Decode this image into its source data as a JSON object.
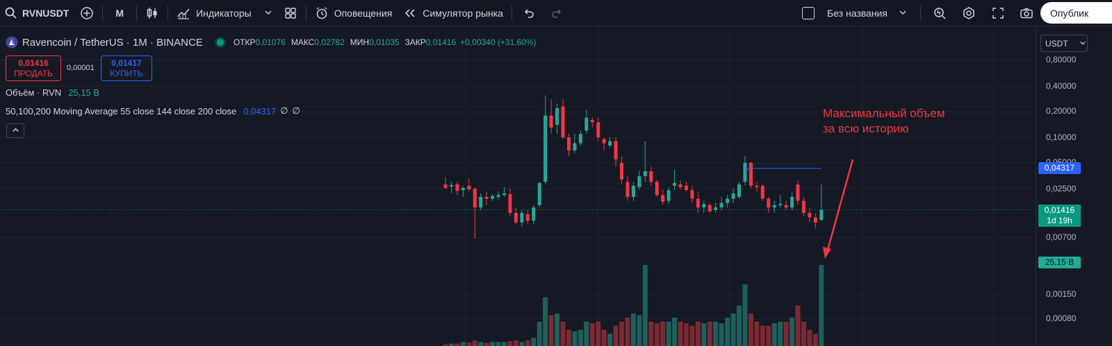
{
  "toolbar": {
    "symbol": "RVNUSDT",
    "interval": "M",
    "indicators_label": "Индикаторы",
    "alerts_label": "Оповещения",
    "replay_label": "Симулятор рынка",
    "layout_name": "Без названия",
    "publish_label": "Опублик"
  },
  "legend": {
    "title": "Ravencoin / TetherUS · 1M · BINANCE",
    "ohlc": [
      {
        "key": "ОТКР",
        "value": "0,01076"
      },
      {
        "key": "МАКС",
        "value": "0,02782"
      },
      {
        "key": "МИН",
        "value": "0,01035"
      },
      {
        "key": "ЗАКР",
        "value": "0,01416"
      }
    ],
    "change": "+0,00340 (+31,60%)",
    "volume_label": "Объём · RVN",
    "volume_value": "25,15 B",
    "ma_label": "50,100,200 Moving Average 55 close 144 close 200 close",
    "ma_value": "0,04317",
    "ma_empty1": "∅",
    "ma_empty2": "∅"
  },
  "trade": {
    "sell_price": "0,01416",
    "sell_label": "ПРОДАТЬ",
    "spread": "0,00001",
    "buy_price": "0,01417",
    "buy_label": "КУПИТЬ"
  },
  "price_axis": {
    "currency": "USDT",
    "ticks": [
      "0,80000",
      "0,40000",
      "0,20000",
      "0,10000",
      "0,05000",
      "0,02500",
      "0,00700",
      "0,00150",
      "0,00080"
    ],
    "ma_badge": "0,04317",
    "price_badge": "0,01416",
    "countdown": "1d 19h",
    "volume_badge": "25,15 B"
  },
  "annotation": {
    "line1": "Максимальный объем",
    "line2": "за всю историю"
  },
  "colors": {
    "up": "#26a69a",
    "down": "#f23645",
    "ma": "#2962ff",
    "annotation": "#f23645"
  },
  "chart_data": {
    "type": "candlestick",
    "symbol": "RVNUSDT",
    "interval": "1M",
    "scale": "log",
    "candles": [
      {
        "o": 0.028,
        "h": 0.034,
        "l": 0.0245,
        "c": 0.0255
      },
      {
        "o": 0.0265,
        "h": 0.03,
        "l": 0.022,
        "c": 0.0275
      },
      {
        "o": 0.028,
        "h": 0.03,
        "l": 0.021,
        "c": 0.0235
      },
      {
        "o": 0.024,
        "h": 0.027,
        "l": 0.02,
        "c": 0.0255
      },
      {
        "o": 0.027,
        "h": 0.033,
        "l": 0.023,
        "c": 0.0245
      },
      {
        "o": 0.025,
        "h": 0.026,
        "l": 0.0065,
        "c": 0.015
      },
      {
        "o": 0.015,
        "h": 0.022,
        "l": 0.014,
        "c": 0.02
      },
      {
        "o": 0.02,
        "h": 0.023,
        "l": 0.016,
        "c": 0.019
      },
      {
        "o": 0.019,
        "h": 0.022,
        "l": 0.018,
        "c": 0.0205
      },
      {
        "o": 0.02,
        "h": 0.023,
        "l": 0.0185,
        "c": 0.021
      },
      {
        "o": 0.021,
        "h": 0.026,
        "l": 0.02,
        "c": 0.022
      },
      {
        "o": 0.0215,
        "h": 0.025,
        "l": 0.012,
        "c": 0.013
      },
      {
        "o": 0.013,
        "h": 0.015,
        "l": 0.0095,
        "c": 0.01
      },
      {
        "o": 0.01,
        "h": 0.014,
        "l": 0.009,
        "c": 0.013
      },
      {
        "o": 0.0125,
        "h": 0.014,
        "l": 0.0095,
        "c": 0.0105
      },
      {
        "o": 0.0105,
        "h": 0.016,
        "l": 0.0095,
        "c": 0.015
      },
      {
        "o": 0.016,
        "h": 0.03,
        "l": 0.015,
        "c": 0.029
      },
      {
        "o": 0.03,
        "h": 0.31,
        "l": 0.028,
        "c": 0.18
      },
      {
        "o": 0.18,
        "h": 0.28,
        "l": 0.11,
        "c": 0.13
      },
      {
        "o": 0.14,
        "h": 0.25,
        "l": 0.11,
        "c": 0.22
      },
      {
        "o": 0.23,
        "h": 0.28,
        "l": 0.095,
        "c": 0.1
      },
      {
        "o": 0.1,
        "h": 0.11,
        "l": 0.06,
        "c": 0.07
      },
      {
        "o": 0.07,
        "h": 0.11,
        "l": 0.065,
        "c": 0.085
      },
      {
        "o": 0.085,
        "h": 0.12,
        "l": 0.08,
        "c": 0.11
      },
      {
        "o": 0.12,
        "h": 0.21,
        "l": 0.11,
        "c": 0.17
      },
      {
        "o": 0.16,
        "h": 0.17,
        "l": 0.13,
        "c": 0.15
      },
      {
        "o": 0.15,
        "h": 0.17,
        "l": 0.09,
        "c": 0.1
      },
      {
        "o": 0.095,
        "h": 0.1,
        "l": 0.07,
        "c": 0.085
      },
      {
        "o": 0.08,
        "h": 0.1,
        "l": 0.075,
        "c": 0.09
      },
      {
        "o": 0.09,
        "h": 0.1,
        "l": 0.045,
        "c": 0.055
      },
      {
        "o": 0.05,
        "h": 0.06,
        "l": 0.028,
        "c": 0.032
      },
      {
        "o": 0.03,
        "h": 0.035,
        "l": 0.018,
        "c": 0.02
      },
      {
        "o": 0.02,
        "h": 0.03,
        "l": 0.018,
        "c": 0.027
      },
      {
        "o": 0.026,
        "h": 0.04,
        "l": 0.024,
        "c": 0.035
      },
      {
        "o": 0.035,
        "h": 0.09,
        "l": 0.03,
        "c": 0.04
      },
      {
        "o": 0.04,
        "h": 0.045,
        "l": 0.027,
        "c": 0.03
      },
      {
        "o": 0.03,
        "h": 0.032,
        "l": 0.02,
        "c": 0.021
      },
      {
        "o": 0.021,
        "h": 0.024,
        "l": 0.016,
        "c": 0.0175
      },
      {
        "o": 0.018,
        "h": 0.026,
        "l": 0.0165,
        "c": 0.024
      },
      {
        "o": 0.027,
        "h": 0.042,
        "l": 0.024,
        "c": 0.029
      },
      {
        "o": 0.028,
        "h": 0.031,
        "l": 0.024,
        "c": 0.026
      },
      {
        "o": 0.027,
        "h": 0.03,
        "l": 0.023,
        "c": 0.024
      },
      {
        "o": 0.024,
        "h": 0.027,
        "l": 0.017,
        "c": 0.019
      },
      {
        "o": 0.019,
        "h": 0.023,
        "l": 0.013,
        "c": 0.015
      },
      {
        "o": 0.015,
        "h": 0.018,
        "l": 0.013,
        "c": 0.0165
      },
      {
        "o": 0.016,
        "h": 0.017,
        "l": 0.013,
        "c": 0.0135
      },
      {
        "o": 0.014,
        "h": 0.017,
        "l": 0.013,
        "c": 0.015
      },
      {
        "o": 0.015,
        "h": 0.02,
        "l": 0.014,
        "c": 0.017
      },
      {
        "o": 0.017,
        "h": 0.021,
        "l": 0.015,
        "c": 0.019
      },
      {
        "o": 0.019,
        "h": 0.025,
        "l": 0.017,
        "c": 0.022
      },
      {
        "o": 0.02,
        "h": 0.03,
        "l": 0.019,
        "c": 0.028
      },
      {
        "o": 0.03,
        "h": 0.06,
        "l": 0.027,
        "c": 0.05
      },
      {
        "o": 0.05,
        "h": 0.052,
        "l": 0.025,
        "c": 0.027
      },
      {
        "o": 0.027,
        "h": 0.03,
        "l": 0.023,
        "c": 0.026
      },
      {
        "o": 0.027,
        "h": 0.028,
        "l": 0.018,
        "c": 0.019
      },
      {
        "o": 0.019,
        "h": 0.02,
        "l": 0.013,
        "c": 0.015
      },
      {
        "o": 0.015,
        "h": 0.018,
        "l": 0.013,
        "c": 0.016
      },
      {
        "o": 0.016,
        "h": 0.021,
        "l": 0.015,
        "c": 0.0165
      },
      {
        "o": 0.016,
        "h": 0.018,
        "l": 0.014,
        "c": 0.015
      },
      {
        "o": 0.015,
        "h": 0.023,
        "l": 0.014,
        "c": 0.02
      },
      {
        "o": 0.028,
        "h": 0.031,
        "l": 0.016,
        "c": 0.018
      },
      {
        "o": 0.018,
        "h": 0.02,
        "l": 0.012,
        "c": 0.013
      },
      {
        "o": 0.013,
        "h": 0.015,
        "l": 0.01,
        "c": 0.0115
      },
      {
        "o": 0.0115,
        "h": 0.013,
        "l": 0.0085,
        "c": 0.01
      },
      {
        "o": 0.01076,
        "h": 0.02782,
        "l": 0.01035,
        "c": 0.01416
      }
    ],
    "volume_relative": [
      0.02,
      0.03,
      0.03,
      0.05,
      0.04,
      0.07,
      0.05,
      0.04,
      0.05,
      0.05,
      0.05,
      0.06,
      0.07,
      0.05,
      0.07,
      0.1,
      0.3,
      0.6,
      0.38,
      0.4,
      0.3,
      0.2,
      0.18,
      0.2,
      0.3,
      0.28,
      0.3,
      0.2,
      0.15,
      0.25,
      0.3,
      0.35,
      0.4,
      0.38,
      1.0,
      0.3,
      0.28,
      0.3,
      0.3,
      0.35,
      0.3,
      0.28,
      0.25,
      0.3,
      0.28,
      0.3,
      0.3,
      0.28,
      0.35,
      0.4,
      0.5,
      0.76,
      0.4,
      0.3,
      0.25,
      0.25,
      0.28,
      0.3,
      0.3,
      0.35,
      0.5,
      0.3,
      0.2,
      0.15,
      1.0
    ],
    "ma_line": {
      "value": 0.04317,
      "from_index": 51,
      "to_index": 64
    },
    "last_price": 0.01416,
    "last_volume": "25,15 B"
  }
}
